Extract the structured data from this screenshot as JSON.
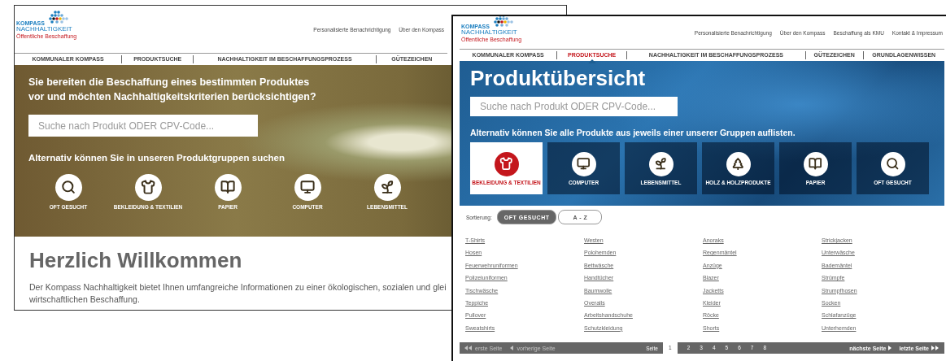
{
  "back_window": {
    "logo": {
      "line_1": "KOMPASS",
      "line_2": "NACHHALTIGKEIT",
      "tagline": "Öffentliche Beschaffung"
    },
    "top_links": [
      "Personalisierte Benachrichtigung",
      "Über den Kompass"
    ],
    "nav": [
      {
        "label": "KOMMUNALER KOMPASS",
        "selected": false
      },
      {
        "label": "PRODUKTSUCHE",
        "selected": false
      },
      {
        "label": "NACHHALTIGKEIT IM BESCHAFFUNGSPROZESS",
        "selected": false
      },
      {
        "label": "GÜTEZEICHEN",
        "selected": false
      }
    ],
    "hero": {
      "heading_lines": [
        "Sie bereiten die Beschaffung eines bestimmten Produktes",
        "vor und möchten Nachhaltigkeitskriterien berücksichtigen?"
      ],
      "search": {
        "placeholder": "Suche nach Produkt ODER CPV-Code..."
      },
      "subheading": "Alternativ können Sie in unseren Produktgruppen suchen",
      "categories": [
        {
          "label": "OFT GESUCHT",
          "selected": false
        },
        {
          "label": "BEKLEIDUNG & TEXTILIEN",
          "selected": false
        },
        {
          "label": "PAPIER",
          "selected": false
        },
        {
          "label": "COMPUTER",
          "selected": false
        },
        {
          "label": "LEBENSMITTEL",
          "selected": false
        }
      ]
    },
    "welcome": {
      "title": "Herzlich Willkommen",
      "body_lines": [
        "Der Kompass Nachhaltigkeit bietet Ihnen umfangreiche Informationen zu einer ökologischen, sozialen und glei",
        "wirtschaftlichen Beschaffung."
      ]
    }
  },
  "front_window": {
    "logo": {
      "line_1": "KOMPASS",
      "line_2": "NACHHALTIGKEIT",
      "tagline": "Öffentliche Beschaffung"
    },
    "top_links": [
      "Personalisierte Benachrichtigung",
      "Über den Kompass",
      "Beschaffung als KMU",
      "Kontakt & Impressum"
    ],
    "nav": [
      {
        "label": "KOMMUNALER KOMPASS",
        "selected": false
      },
      {
        "label": "PRODUKTSUCHE",
        "selected": true
      },
      {
        "label": "NACHHALTIGKEIT IM BESCHAFFUNGSPROZESS",
        "selected": false
      },
      {
        "label": "GÜTEZEICHEN",
        "selected": false
      },
      {
        "label": "GRUNDLAGENWISSEN",
        "selected": false
      }
    ],
    "hero": {
      "title": "Produktübersicht",
      "search": {
        "placeholder": "Suche nach Produkt ODER CPV-Code..."
      },
      "subheading": "Alternativ können Sie alle Produkte aus jeweils einer unserer Gruppen auflisten.",
      "categories": [
        {
          "label": "BEKLEIDUNG & TEXTILIEN",
          "selected": true
        },
        {
          "label": "COMPUTER",
          "selected": false
        },
        {
          "label": "LEBENSMITTEL",
          "selected": false
        },
        {
          "label": "HOLZ & HOLZPRODUKTE",
          "selected": false
        },
        {
          "label": "PAPIER",
          "selected": false
        },
        {
          "label": "OFT GESUCHT",
          "selected": false
        }
      ]
    },
    "sorting": {
      "label": "Sortierung:",
      "options": [
        {
          "label": "OFT GESUCHT",
          "selected": true
        },
        {
          "label": "A - Z",
          "selected": false
        }
      ]
    },
    "product_columns": [
      [
        "T-Shirts",
        "Hosen",
        "Feuerwehruniformen",
        "Polizeiuniformen",
        "Tischwäsche",
        "Teppiche",
        "Pullover",
        "Sweatshirts"
      ],
      [
        "Westen",
        "Polohemden",
        "Bettwäsche",
        "Handtücher",
        "Baumwolle",
        "Overalls",
        "Arbeitshandschuhe",
        "Schutzkleidung"
      ],
      [
        "Anoraks",
        "Regenmäntel",
        "Anzüge",
        "Blazer",
        "Jacketts",
        "Kleider",
        "Röcke",
        "Shorts"
      ],
      [
        "Strickjacken",
        "Unterwäsche",
        "Bademäntel",
        "Strümpfe",
        "Strumpfhosen",
        "Socken",
        "Schlafanzüge",
        "Unterhemden"
      ]
    ],
    "pagination": {
      "first": {
        "label": "erste Seite",
        "disabled": true
      },
      "previous": {
        "label": "vorherige Seite",
        "disabled": true
      },
      "page_label": "Seite",
      "pages": [
        {
          "label": "1",
          "selected": true
        },
        {
          "label": "2",
          "selected": false
        },
        {
          "label": "3",
          "selected": false
        },
        {
          "label": "4",
          "selected": false
        },
        {
          "label": "5",
          "selected": false
        },
        {
          "label": "6",
          "selected": false
        },
        {
          "label": "7",
          "selected": false
        },
        {
          "label": "8",
          "selected": false
        }
      ],
      "next": {
        "label": "nächste Seite",
        "disabled": false
      },
      "last": {
        "label": "letzte Seite",
        "disabled": false
      }
    }
  }
}
